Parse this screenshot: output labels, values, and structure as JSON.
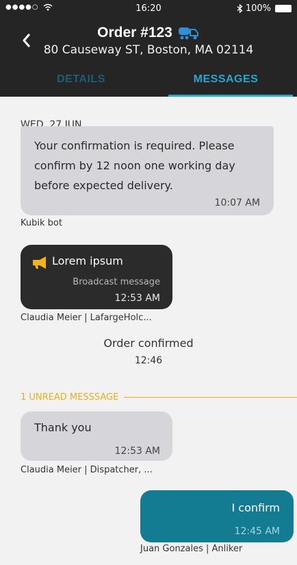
{
  "status_bar": {
    "signal": "●●●●○",
    "time": "16:20",
    "battery": "100%"
  },
  "header": {
    "title": "Order #123",
    "subtitle": "80 Causeway ST, Boston, MA 02114",
    "icon": "truck-icon"
  },
  "tabs": [
    {
      "label": "DETAILS",
      "active": false
    },
    {
      "label": "MESSAGES",
      "active": true
    }
  ],
  "messages": {
    "date": "WED, 27 JUN",
    "bot": {
      "lines": [
        "Your confirmation is required. Please",
        "confirm by 12 noon one working day",
        "before expected delivery."
      ],
      "time": "10:07 AM",
      "sender": "Kubik bot"
    },
    "broadcast": {
      "title": "Lorem ipsum",
      "subtitle": "Broadcast message",
      "time": "12:53 AM",
      "sender": "Claudia Meier | LafargeHolc..."
    },
    "system": {
      "text": "Order confirmed",
      "time": "12:46"
    },
    "unread_label": "1 UNREAD MESSSAGE",
    "reply": {
      "text": "Thank you",
      "time": "12:53 AM",
      "sender": "Claudia Meier | Dispatcher, ..."
    },
    "outgoing": {
      "text": "I confirm",
      "time": "12:45 AM",
      "sender": "Juan Gonzales | Anliker"
    }
  },
  "colors": {
    "header_bg": "#252525",
    "accent": "#28a6cd",
    "unread": "#e8b018",
    "outgoing_bubble": "#137c93"
  }
}
